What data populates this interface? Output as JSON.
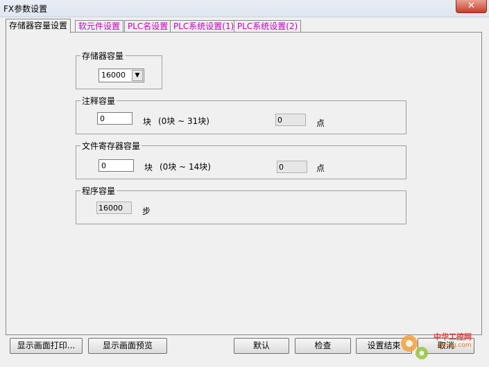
{
  "window": {
    "title": "FX参数设置",
    "close_label": "✕"
  },
  "tabs": [
    "存储器容量设置",
    "软元件设置",
    "PLC名设置",
    "PLC系统设置(1)",
    "PLC系统设置(2)"
  ],
  "memory": {
    "label": "存储器容量",
    "value": "16000",
    "arrow": "▼"
  },
  "comment": {
    "label": "注释容量",
    "input": "0",
    "unit": "块",
    "range": "(0块 ~ 31块)",
    "points": "0",
    "points_unit": "点"
  },
  "file_register": {
    "label": "文件寄存器容量",
    "input": "0",
    "unit": "块",
    "range": "(0块 ~ 14块)",
    "points": "0",
    "points_unit": "点"
  },
  "program": {
    "label": "程序容量",
    "value": "16000",
    "unit": "步"
  },
  "buttons": {
    "print": "显示画面打印...",
    "preview": "显示画面预览",
    "default": "默认",
    "check": "检查",
    "finish": "设置结束",
    "cancel": "取消"
  },
  "watermark": {
    "text": "中华工控网",
    "sub": "gkong.com"
  }
}
